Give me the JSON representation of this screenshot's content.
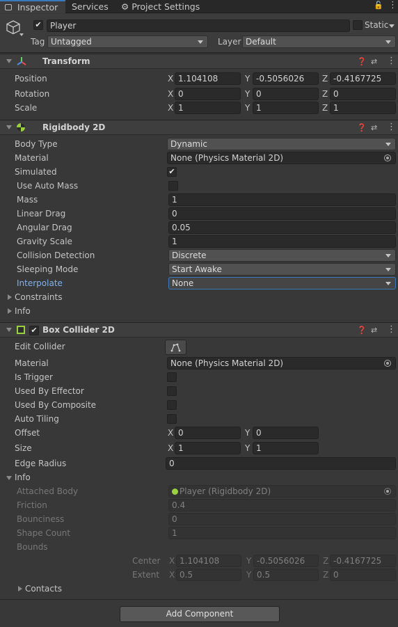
{
  "tabs": {
    "inspector": "Inspector",
    "services": "Services",
    "project_settings": "Project Settings"
  },
  "object": {
    "name": "Player",
    "static_label": "Static",
    "tag_label": "Tag",
    "tag_value": "Untagged",
    "layer_label": "Layer",
    "layer_value": "Default"
  },
  "transform": {
    "title": "Transform",
    "position": {
      "label": "Position",
      "x": "1.104108",
      "y": "-0.5056026",
      "z": "-0.4167725"
    },
    "rotation": {
      "label": "Rotation",
      "x": "0",
      "y": "0",
      "z": "0"
    },
    "scale": {
      "label": "Scale",
      "x": "1",
      "y": "1",
      "z": "1"
    }
  },
  "rigidbody": {
    "title": "Rigidbody 2D",
    "body_type": {
      "label": "Body Type",
      "value": "Dynamic"
    },
    "material": {
      "label": "Material",
      "value": "None (Physics Material 2D)"
    },
    "simulated": {
      "label": "Simulated"
    },
    "use_auto_mass": {
      "label": "Use Auto Mass"
    },
    "mass": {
      "label": "Mass",
      "value": "1"
    },
    "linear_drag": {
      "label": "Linear Drag",
      "value": "0"
    },
    "angular_drag": {
      "label": "Angular Drag",
      "value": "0.05"
    },
    "gravity_scale": {
      "label": "Gravity Scale",
      "value": "1"
    },
    "collision_detection": {
      "label": "Collision Detection",
      "value": "Discrete"
    },
    "sleeping_mode": {
      "label": "Sleeping Mode",
      "value": "Start Awake"
    },
    "interpolate": {
      "label": "Interpolate",
      "value": "None"
    },
    "constraints": "Constraints",
    "info": "Info"
  },
  "box_collider": {
    "title": "Box Collider 2D",
    "edit_collider": "Edit Collider",
    "material": {
      "label": "Material",
      "value": "None (Physics Material 2D)"
    },
    "is_trigger": "Is Trigger",
    "used_by_effector": "Used By Effector",
    "used_by_composite": "Used By Composite",
    "auto_tiling": "Auto Tiling",
    "offset": {
      "label": "Offset",
      "x": "0",
      "y": "0"
    },
    "size": {
      "label": "Size",
      "x": "1",
      "y": "1"
    },
    "edge_radius": {
      "label": "Edge Radius",
      "value": "0"
    },
    "info": {
      "label": "Info",
      "attached_body": {
        "label": "Attached Body",
        "value": "Player (Rigidbody 2D)"
      },
      "friction": {
        "label": "Friction",
        "value": "0.4"
      },
      "bounciness": {
        "label": "Bounciness",
        "value": "0"
      },
      "shape_count": {
        "label": "Shape Count",
        "value": "1"
      },
      "bounds": "Bounds",
      "center": {
        "label": "Center",
        "x": "1.104108",
        "y": "-0.5056026",
        "z": "-0.4167725"
      },
      "extent": {
        "label": "Extent",
        "x": "0.5",
        "y": "0.5",
        "z": "0"
      },
      "contacts": "Contacts"
    }
  },
  "add_component": "Add Component",
  "axes": {
    "x": "X",
    "y": "Y",
    "z": "Z"
  },
  "colors": {
    "accent": "#3a79bb",
    "interpolate_label": "#7fb2f0",
    "background": "#383838"
  }
}
